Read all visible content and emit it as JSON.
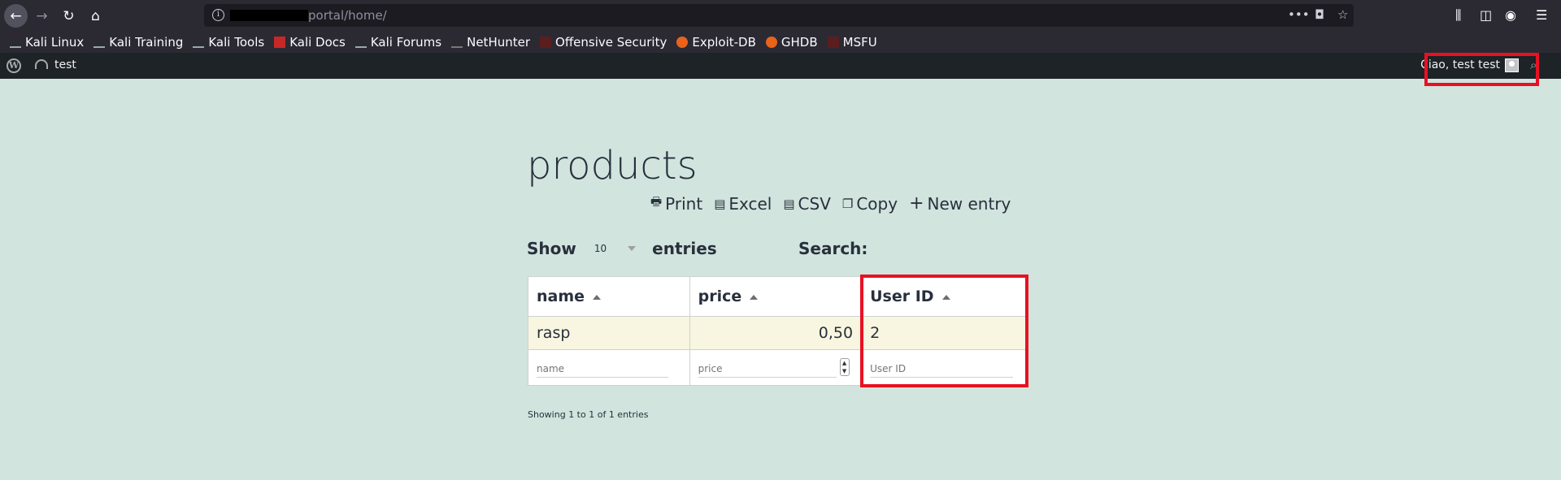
{
  "browser": {
    "url_visible": "portal/home/",
    "bookmarks": [
      "Kali Linux",
      "Kali Training",
      "Kali Tools",
      "Kali Docs",
      "Kali Forums",
      "NetHunter",
      "Offensive Security",
      "Exploit-DB",
      "GHDB",
      "MSFU"
    ]
  },
  "adminbar": {
    "site_name": "test",
    "greeting": "Ciao, test test"
  },
  "page": {
    "title": "products",
    "buttons": [
      "Print",
      "Excel",
      "CSV",
      "Copy",
      "New entry"
    ],
    "show_label": "Show",
    "entries_label": "entries",
    "length_value": "10",
    "search_label": "Search:",
    "columns": [
      "name",
      "price",
      "User ID"
    ],
    "rows": [
      {
        "name": "rasp",
        "price": "0,50",
        "user_id": "2"
      }
    ],
    "filters": [
      "name",
      "price",
      "User ID"
    ],
    "info": "Showing 1 to 1 of 1 entries"
  },
  "colors": {
    "background": "#d1e4dd",
    "highlight": "#e81123",
    "row": "#f8f6e0"
  }
}
